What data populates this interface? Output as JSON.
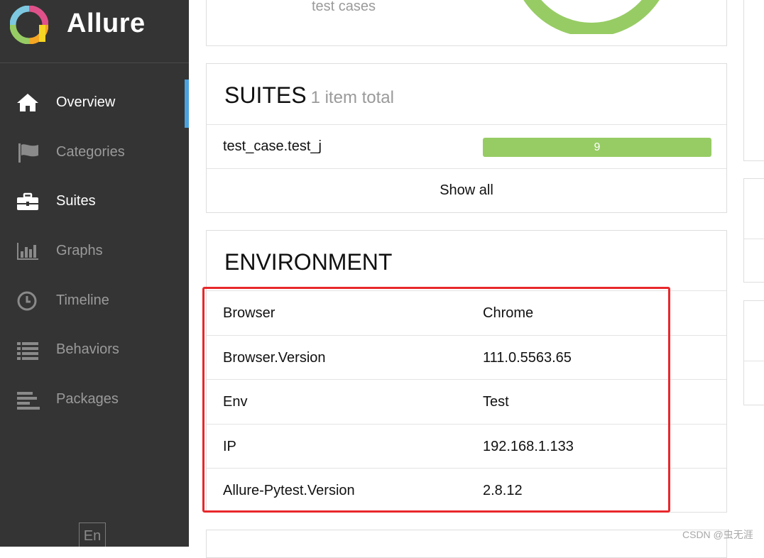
{
  "app": {
    "title": "Allure"
  },
  "sidebar": {
    "items": [
      {
        "label": "Overview",
        "icon": "home-icon"
      },
      {
        "label": "Categories",
        "icon": "flag-icon"
      },
      {
        "label": "Suites",
        "icon": "briefcase-icon"
      },
      {
        "label": "Graphs",
        "icon": "bar-chart-icon"
      },
      {
        "label": "Timeline",
        "icon": "clock-icon"
      },
      {
        "label": "Behaviors",
        "icon": "list-icon"
      },
      {
        "label": "Packages",
        "icon": "align-left-icon"
      }
    ],
    "active_item": "Overview",
    "language": "En"
  },
  "test_cases_widget": {
    "caption": "test cases",
    "ring_color": "#97cc64"
  },
  "suites": {
    "title": "SUITES",
    "subtitle": "1 item total",
    "rows": [
      {
        "name": "test_case.test_j",
        "count": "9"
      }
    ],
    "show_all_label": "Show all",
    "bar_color": "#97cc64"
  },
  "environment": {
    "title": "ENVIRONMENT",
    "rows": [
      {
        "key": "Browser",
        "value": "Chrome"
      },
      {
        "key": "Browser.Version",
        "value": "111.0.5563.65"
      },
      {
        "key": "Env",
        "value": "Test"
      },
      {
        "key": "IP",
        "value": "192.168.1.133"
      },
      {
        "key": "Allure-Pytest.Version",
        "value": "2.8.12"
      }
    ],
    "highlight_color": "#e8282b"
  },
  "watermark": "CSDN @虫无涯",
  "colors": {
    "sidebar_bg": "#343434",
    "active_accent": "#4aa3df"
  }
}
